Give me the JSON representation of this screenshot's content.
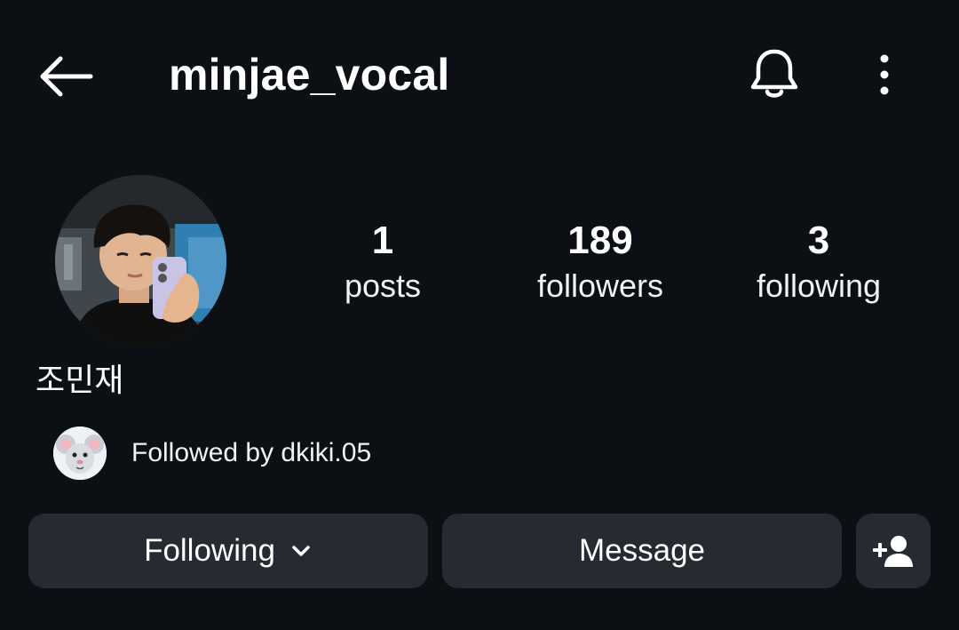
{
  "header": {
    "username": "minjae_vocal",
    "back_icon": "arrow-left-icon",
    "notifications_icon": "bell-icon",
    "more_icon": "more-vertical-icon"
  },
  "profile": {
    "display_name": "조민재",
    "avatar": "profile-photo"
  },
  "stats": {
    "posts": {
      "count": "1",
      "label": "posts"
    },
    "followers": {
      "count": "189",
      "label": "followers"
    },
    "following": {
      "count": "3",
      "label": "following"
    }
  },
  "mutual": {
    "text": "Followed by dkiki.05",
    "avatar": "mouse-avatar"
  },
  "actions": {
    "following_label": "Following",
    "message_label": "Message",
    "add_user_icon": "person-add-icon"
  },
  "colors": {
    "background": "#0c0f14",
    "button_bg": "#262a31",
    "text": "#ffffff"
  }
}
